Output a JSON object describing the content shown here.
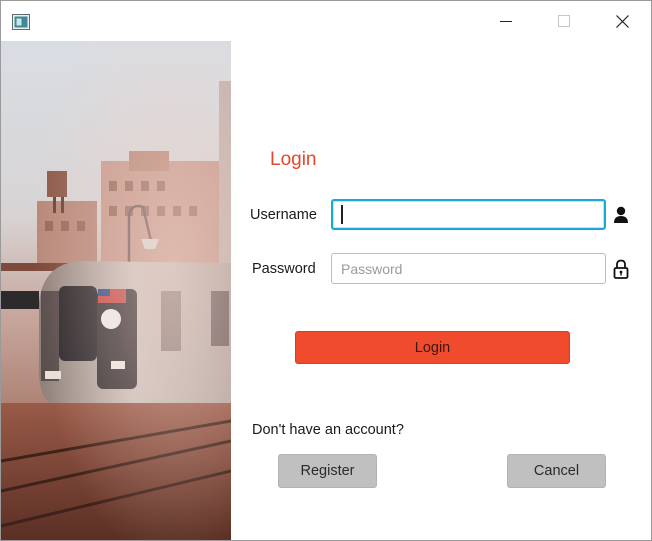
{
  "titlebar": {
    "icon": "app-window-icon",
    "minimize_icon": "minimize-icon",
    "maximize_icon": "maximize-icon",
    "close_icon": "close-icon"
  },
  "side_image": {
    "subject": "train-photo"
  },
  "form": {
    "title": "Login",
    "username_label": "Username",
    "username_value": "",
    "username_placeholder": "",
    "username_icon": "user-icon",
    "password_label": "Password",
    "password_value": "",
    "password_placeholder": "Password",
    "password_icon": "lock-icon",
    "login_button": "Login",
    "no_account_text": "Don't have an account?",
    "register_button": "Register",
    "cancel_button": "Cancel"
  },
  "colors": {
    "accent": "#ef4b2c",
    "title_text": "#e2482d",
    "focus_border": "#1aa7db",
    "secondary_button": "#c0c0c0"
  }
}
